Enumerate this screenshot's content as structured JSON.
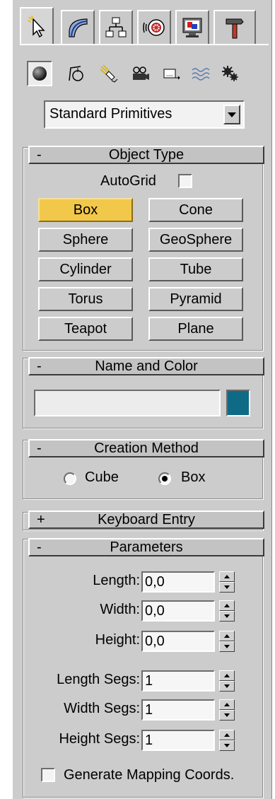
{
  "tabs": [
    {
      "icon": "create-arrow-icon",
      "active": true
    },
    {
      "icon": "modify-bend-icon"
    },
    {
      "icon": "hierarchy-icon"
    },
    {
      "icon": "motion-icon"
    },
    {
      "icon": "display-monitor-icon"
    },
    {
      "icon": "utilities-hammer-icon"
    }
  ],
  "categories": [
    {
      "icon": "geometry-sphere-icon",
      "active": true
    },
    {
      "icon": "shapes-icon"
    },
    {
      "icon": "lights-icon"
    },
    {
      "icon": "cameras-icon"
    },
    {
      "icon": "helpers-icon"
    },
    {
      "icon": "space-warps-icon"
    },
    {
      "icon": "systems-icon"
    }
  ],
  "dropdown": {
    "selected": "Standard Primitives"
  },
  "object_type": {
    "sign": "-",
    "title": "Object Type",
    "autogrid_label": "AutoGrid",
    "autogrid_checked": false,
    "buttons": [
      "Box",
      "Cone",
      "Sphere",
      "GeoSphere",
      "Cylinder",
      "Tube",
      "Torus",
      "Pyramid",
      "Teapot",
      "Plane"
    ],
    "active_button": "Box"
  },
  "name_and_color": {
    "sign": "-",
    "title": "Name and Color",
    "name_value": "",
    "color": "#0f6a86"
  },
  "creation_method": {
    "sign": "-",
    "title": "Creation Method",
    "options": [
      "Cube",
      "Box"
    ],
    "selected": "Box"
  },
  "keyboard_entry": {
    "sign": "+",
    "title": "Keyboard Entry"
  },
  "parameters": {
    "sign": "-",
    "title": "Parameters",
    "length_label": "Length:",
    "length": "0,0",
    "width_label": "Width:",
    "width": "0,0",
    "height_label": "Height:",
    "height": "0,0",
    "length_segs_label": "Length Segs:",
    "length_segs": "1",
    "width_segs_label": "Width Segs:",
    "width_segs": "1",
    "height_segs_label": "Height Segs:",
    "height_segs": "1",
    "mapping_label": "Generate Mapping Coords.",
    "mapping_checked": false
  },
  "colors": {
    "active_button": "#f2c84b",
    "panel": "#cccccc"
  }
}
